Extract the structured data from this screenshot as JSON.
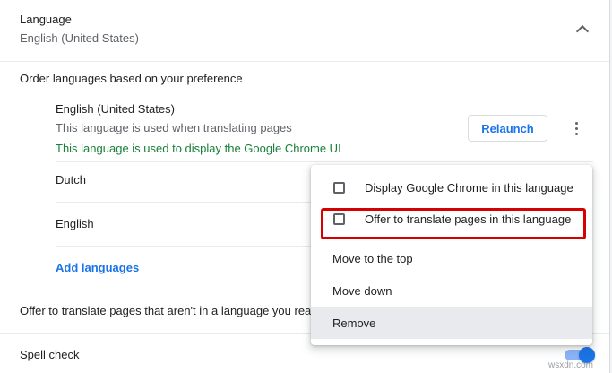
{
  "language_section": {
    "title": "Language",
    "subtitle": "English (United States)"
  },
  "order_label": "Order languages based on your preference",
  "languages": [
    {
      "name": "English (United States)",
      "note": "This language is used when translating pages",
      "ui_note": "This language is used to display the Google Chrome UI",
      "relaunch_label": "Relaunch"
    },
    {
      "name": "Dutch"
    },
    {
      "name": "English"
    }
  ],
  "add_languages_label": "Add languages",
  "offer_translate_label": "Offer to translate pages that aren't in a language you rea",
  "spell_check_label": "Spell check",
  "spell_check_enabled": true,
  "context_menu": {
    "items": [
      {
        "label": "Display Google Chrome in this language",
        "checkbox": true,
        "checked": false
      },
      {
        "label": "Offer to translate pages in this language",
        "checkbox": true,
        "checked": false
      },
      {
        "label": "Move to the top"
      },
      {
        "label": "Move down"
      },
      {
        "label": "Remove"
      }
    ]
  },
  "colors": {
    "accent": "#1a73e8",
    "success_green": "#188038",
    "highlight_red": "#d50000"
  },
  "icons": {
    "collapse": "chevron-up-icon",
    "more": "more-vert-icon"
  },
  "watermark": "wsxdn.com"
}
